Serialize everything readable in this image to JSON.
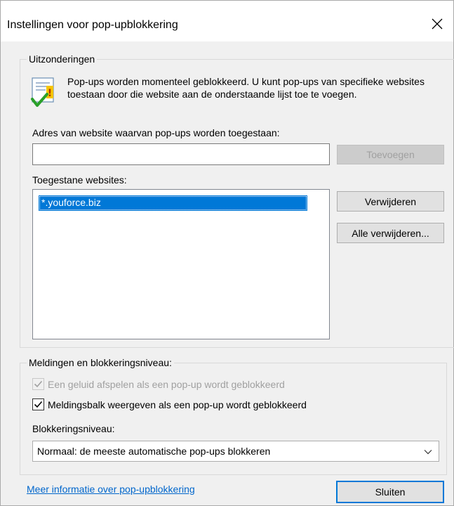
{
  "window": {
    "title": "Instellingen voor pop-upblokkering"
  },
  "exceptions": {
    "legend": "Uitzonderingen",
    "info_text": "Pop-ups worden momenteel geblokkeerd. U kunt pop-ups van specifieke websites toestaan door die website aan de onderstaande lijst toe te voegen.",
    "address_label": "Adres van website waarvan pop-ups worden toegestaan:",
    "address_value": "",
    "add_button": "Toevoegen",
    "allowed_label": "Toegestane websites:",
    "allowed_sites": [
      "*.youforce.biz"
    ],
    "remove_button": "Verwijderen",
    "remove_all_button": "Alle verwijderen..."
  },
  "notifications": {
    "legend": "Meldingen en blokkeringsniveau:",
    "sound_label": "Een geluid afspelen als een pop-up wordt geblokkeerd",
    "sound_checked": true,
    "bar_label": "Meldingsbalk weergeven als een pop-up wordt geblokkeerd",
    "bar_checked": true,
    "level_label": "Blokkeringsniveau:",
    "level_value": "Normaal: de meeste automatische pop-ups blokkeren"
  },
  "footer": {
    "more_info_link": "Meer informatie over pop-upblokkering",
    "close_button": "Sluiten"
  },
  "colors": {
    "accent": "#0078d7",
    "link": "#0066cc",
    "dialog_bg": "#f0f0f0"
  }
}
